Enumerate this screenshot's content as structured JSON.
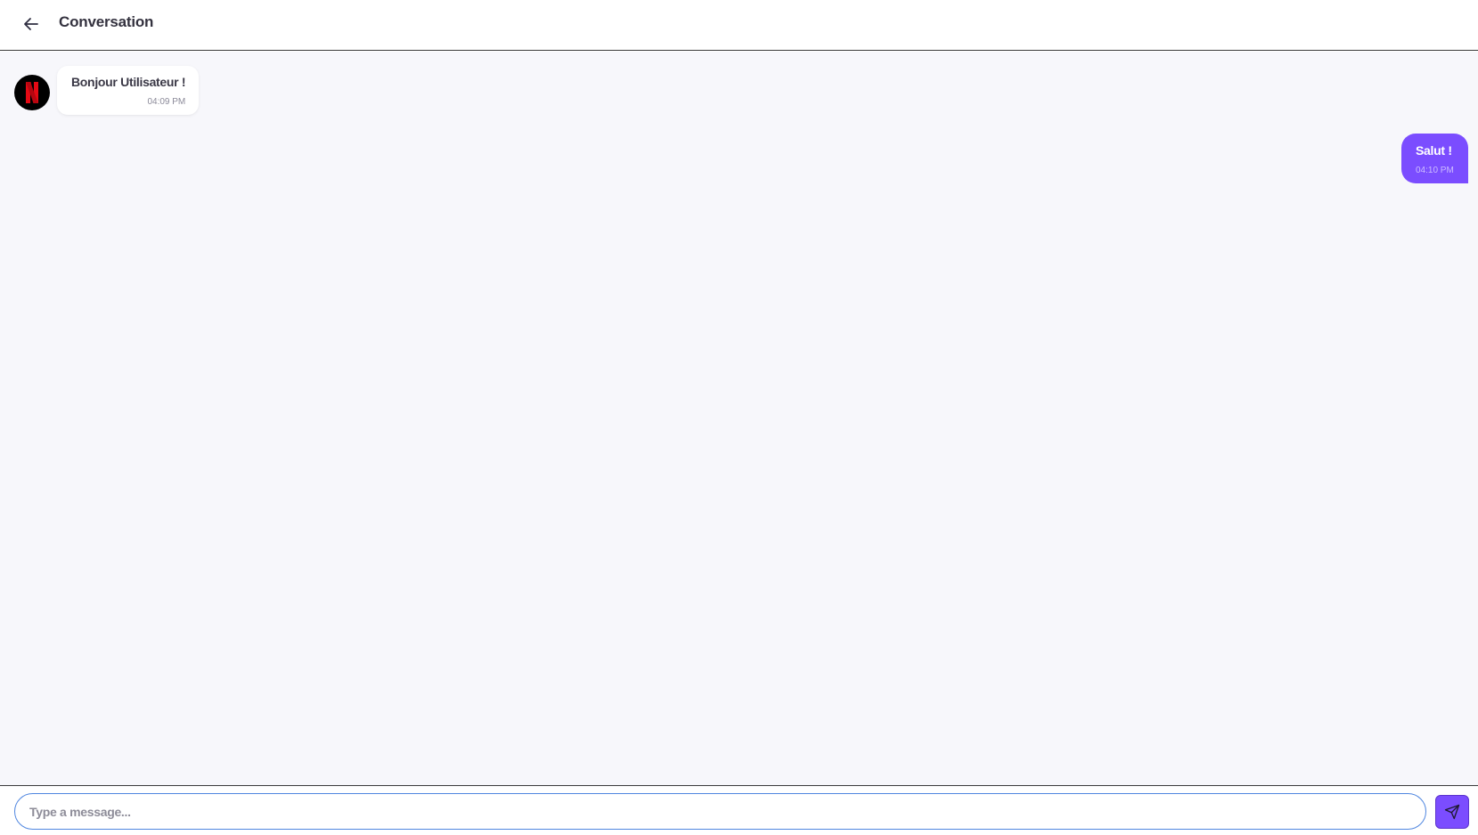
{
  "header": {
    "back_icon": "arrow-left-icon",
    "title": "Conversation"
  },
  "messages": [
    {
      "direction": "incoming",
      "avatar_icon": "netflix-logo",
      "text": "Bonjour Utilisateur !",
      "time": "04:09 PM"
    },
    {
      "direction": "outgoing",
      "text": "Salut !",
      "time": "04:10 PM"
    }
  ],
  "composer": {
    "placeholder": "Type a message...",
    "value": "",
    "send_icon": "send-icon"
  },
  "colors": {
    "accent": "#7b4dff",
    "chat_background": "#f7f7fb",
    "input_border": "#4f86e0",
    "avatar_letter": "#e50914"
  }
}
